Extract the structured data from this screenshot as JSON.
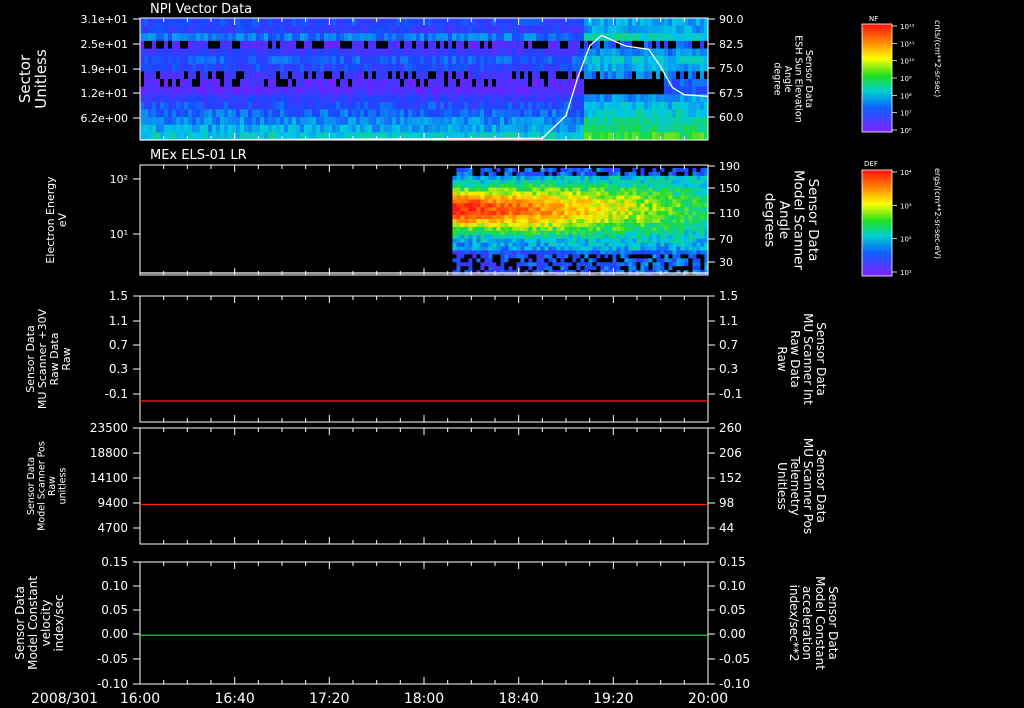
{
  "colors": {
    "background": "#000000",
    "axis": "#ffffff",
    "red_trace": "#ff2020",
    "green_trace": "#30e030",
    "white_trace": "#ffffff"
  },
  "time_axis": {
    "date_label": "2008/301",
    "ticks": [
      "16:00",
      "16:40",
      "17:20",
      "18:00",
      "18:40",
      "19:20",
      "20:00"
    ]
  },
  "panels": [
    {
      "title": "NPI Vector Data",
      "left_label": [
        "Sector",
        "Unitless"
      ],
      "left_ticks": [
        "3.1e+01",
        "2.5e+01",
        "1.9e+01",
        "1.2e+01",
        "6.2e+00"
      ],
      "right_label": [
        "Sensor Data",
        "ESH Sun Elevation",
        "Angle",
        "degree"
      ],
      "right_ticks": [
        "90.0",
        "82.5",
        "75.0",
        "67.5",
        "60.0"
      ],
      "colorbar": {
        "tag": "NF",
        "unit": "cnts/(cm**2-sr-sec)",
        "tick_labels": [
          "10¹²",
          "10¹¹",
          "10¹⁰",
          "10⁹",
          "10⁸",
          "10⁷",
          "10⁶"
        ]
      }
    },
    {
      "title": "MEx ELS-01 LR",
      "left_label": [
        "Electron Energy",
        "eV"
      ],
      "left_ticks": [
        "10²",
        "10¹"
      ],
      "right_label": [
        "Sensor Data",
        "Model Scanner",
        "Angle",
        "degrees"
      ],
      "right_ticks": [
        "190",
        "150",
        "110",
        "70",
        "30"
      ],
      "colorbar": {
        "tag": "DEF",
        "unit": "ergs/(cm**2-sr-sec-eV)",
        "tick_labels": [
          "10⁴",
          "10³",
          "10²",
          "10¹"
        ]
      }
    },
    {
      "left_label": [
        "Sensor Data",
        "MU Scanner +30V",
        "Raw Data",
        "Raw"
      ],
      "left_ticks": [
        "1.5",
        "1.1",
        "0.7",
        "0.3",
        "-0.1"
      ],
      "right_label": [
        "Sensor Data",
        "MU Scanner Int",
        "Raw Data",
        "Raw"
      ],
      "right_ticks": [
        "1.5",
        "1.1",
        "0.7",
        "0.3",
        "-0.1"
      ]
    },
    {
      "left_label": [
        "Sensor Data",
        "Model Scanner Pos",
        "Raw",
        "unitless"
      ],
      "left_ticks": [
        "23500",
        "18800",
        "14100",
        "9400",
        "4700"
      ],
      "right_label": [
        "Sensor Data",
        "MU Scanner Pos",
        "Telemetry",
        "Unitless"
      ],
      "right_ticks": [
        "260",
        "206",
        "152",
        "98",
        "44"
      ]
    },
    {
      "left_label": [
        "Sensor Data",
        "Model Constant",
        "velocity",
        "index/sec"
      ],
      "left_ticks": [
        "0.15",
        "0.10",
        "0.05",
        "0.00",
        "-0.05",
        "-0.10"
      ],
      "right_label": [
        "Sensor Data",
        "Model Constant",
        "acceleration",
        "index/sec**2"
      ],
      "right_ticks": [
        "0.15",
        "0.10",
        "0.05",
        "0.00",
        "-0.05",
        "-0.10"
      ]
    }
  ],
  "chart_data": [
    {
      "type": "heatmap",
      "title": "NPI Vector Data",
      "x": [
        "16:00",
        "20:00"
      ],
      "ylabel": "Sector Unitless",
      "y_ticks": [
        31,
        25,
        19,
        12,
        6.2
      ],
      "overlay_line": {
        "axis": "Sensor Data ESH Sun Elevation Angle degree",
        "ylim": [
          55,
          90
        ],
        "points": [
          [
            "16:00",
            55
          ],
          [
            "18:50",
            55.5
          ],
          [
            "19:00",
            62
          ],
          [
            "19:05",
            73
          ],
          [
            "19:10",
            82
          ],
          [
            "19:15",
            85
          ],
          [
            "19:25",
            82
          ],
          [
            "19:35",
            81
          ],
          [
            "19:40",
            76
          ],
          [
            "19:45",
            70
          ],
          [
            "19:50",
            68
          ],
          [
            "20:00",
            67.5
          ]
        ]
      }
    },
    {
      "type": "heatmap",
      "title": "MEx ELS-01 LR",
      "x": [
        "16:00",
        "20:00"
      ],
      "ylabel": "Electron Energy eV",
      "y_scale": "log",
      "y_ticks": [
        100,
        10
      ],
      "data_start": "18:12",
      "overlay_line": {
        "axis": "Sensor Data Model Scanner Angle degrees",
        "ylim": [
          0,
          190
        ],
        "points": [
          [
            "16:00",
            0
          ],
          [
            "20:00",
            0
          ]
        ]
      }
    },
    {
      "type": "line",
      "x": [
        "16:00",
        "20:00"
      ],
      "ylabel": "Sensor Data MU Scanner +30V Raw Data Raw",
      "ylim": [
        -0.3,
        1.5
      ],
      "series": [
        {
          "values": [
            0,
            0
          ],
          "color": "#ff2020"
        }
      ]
    },
    {
      "type": "line",
      "x": [
        "16:00",
        "20:00"
      ],
      "ylabel": "Sensor Data Model Scanner Pos Raw unitless",
      "ylim": [
        0,
        23500
      ],
      "series": [
        {
          "values": [
            8000,
            8000
          ],
          "color": "#ff2020"
        }
      ]
    },
    {
      "type": "line",
      "x": [
        "16:00",
        "20:00"
      ],
      "ylabel": "Sensor Data Model Constant velocity index/sec",
      "ylim": [
        -0.1,
        0.15
      ],
      "series": [
        {
          "values": [
            0,
            0
          ],
          "color": "#30e030"
        }
      ]
    }
  ]
}
